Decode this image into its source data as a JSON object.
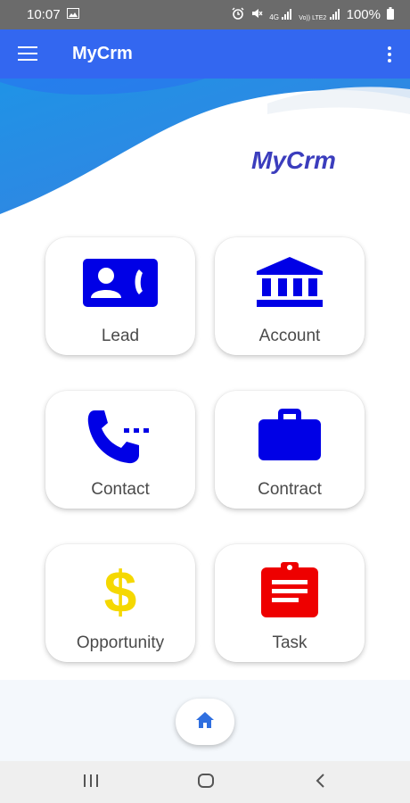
{
  "status_bar": {
    "time": "10:07",
    "battery": "100%",
    "icons": [
      "gallery-icon",
      "alarm-icon",
      "mute-icon",
      "4g-signal-icon",
      "volte-signal-icon",
      "battery-icon"
    ],
    "network_4g": "4G",
    "network_volte": "Vo)) LTE2"
  },
  "app_bar": {
    "title": "MyCrm",
    "color": "#3367f0"
  },
  "header": {
    "brand": "MyCrm",
    "brand_color": "#3b3dbd",
    "wave_color": "#2f8ee2"
  },
  "tiles": [
    {
      "label": "Lead",
      "icon": "contact-card-icon",
      "color": "#0000e6"
    },
    {
      "label": "Account",
      "icon": "bank-icon",
      "color": "#0000e6"
    },
    {
      "label": "Contact",
      "icon": "phone-icon",
      "color": "#0000e6"
    },
    {
      "label": "Contract",
      "icon": "briefcase-icon",
      "color": "#0000e6"
    },
    {
      "label": "Opportunity",
      "icon": "dollar-icon",
      "color": "#f5d800"
    },
    {
      "label": "Task",
      "icon": "clipboard-icon",
      "color": "#ee0000"
    }
  ],
  "bottom_nav": {
    "home_icon": "home-icon",
    "home_color": "#2f6fe0"
  },
  "system_nav": [
    "recent-apps-icon",
    "home-circle-icon",
    "back-icon"
  ]
}
